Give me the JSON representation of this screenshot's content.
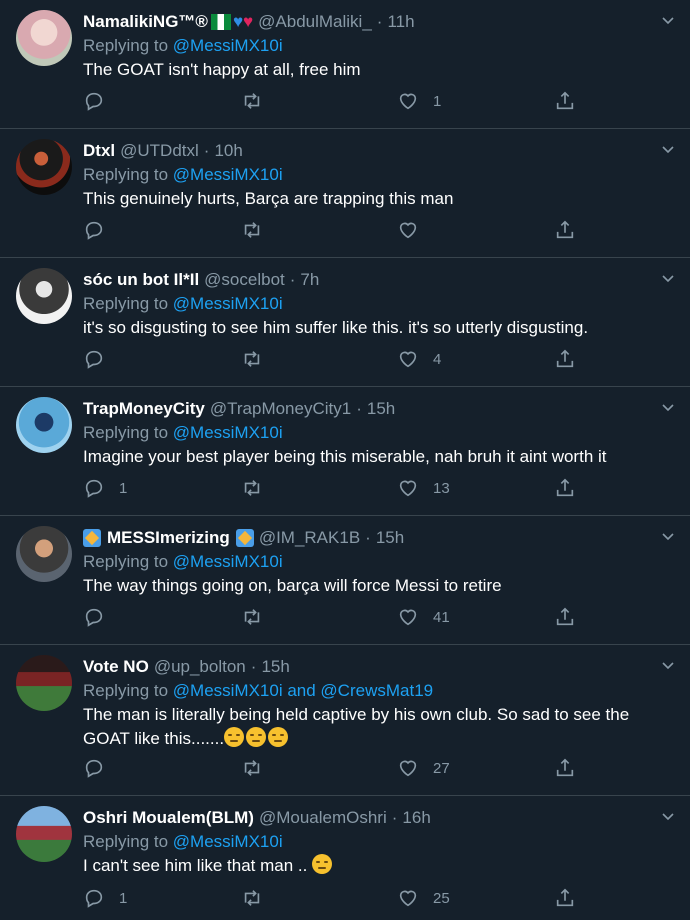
{
  "tweets": [
    {
      "name": "NamalikiNG™®",
      "handle": "@AbdulMaliki_",
      "time": "11h",
      "reply_prefix": "Replying to ",
      "reply_to": "@MessiMX10i",
      "text": "The GOAT isn't happy at all, free him",
      "replies": "",
      "likes": "1"
    },
    {
      "name": "Dtxl",
      "handle": "@UTDdtxl",
      "time": "10h",
      "reply_prefix": "Replying to ",
      "reply_to": "@MessiMX10i",
      "text": "This genuinely hurts, Barça are trapping this man",
      "replies": "",
      "likes": ""
    },
    {
      "name": "sóc un bot Il*Il",
      "handle": "@socelbot",
      "time": "7h",
      "reply_prefix": "Replying to ",
      "reply_to": "@MessiMX10i",
      "text": "it's so disgusting to see him suffer like this. it's so utterly disgusting.",
      "replies": "",
      "likes": "4"
    },
    {
      "name": "TrapMoneyCity",
      "handle": "@TrapMoneyCity1",
      "time": "15h",
      "reply_prefix": "Replying to ",
      "reply_to": "@MessiMX10i",
      "text": "Imagine your best player being this miserable, nah bruh it aint worth it",
      "replies": "1",
      "likes": "13"
    },
    {
      "name": "MESSImerizing",
      "handle": "@IM_RAK1B",
      "time": "15h",
      "reply_prefix": "Replying to ",
      "reply_to": "@MessiMX10i",
      "text": "The way things going on, barça will force Messi to retire",
      "replies": "",
      "likes": "41"
    },
    {
      "name": "Vote NO",
      "handle": "@up_bolton",
      "time": "15h",
      "reply_prefix": "Replying to ",
      "reply_to": "@MessiMX10i and @CrewsMat19",
      "text": "The man is literally being held captive by his own club. So sad to see the GOAT like this.......",
      "replies": "",
      "likes": "27"
    },
    {
      "name": "Oshri Moualem(BLM)",
      "handle": "@MoualemOshri",
      "time": "16h",
      "reply_prefix": "Replying to ",
      "reply_to": "@MessiMX10i",
      "text": "I can't see him like that man ..",
      "replies": "1",
      "likes": "25"
    }
  ],
  "icons": {
    "reply": "reply-icon",
    "retweet": "retweet-icon",
    "like": "like-icon",
    "share": "share-icon",
    "caret": "chevron-down-icon"
  },
  "colors": {
    "background": "#15202b",
    "divider": "#38444d",
    "muted": "#8899a6",
    "link": "#1da1f2"
  }
}
